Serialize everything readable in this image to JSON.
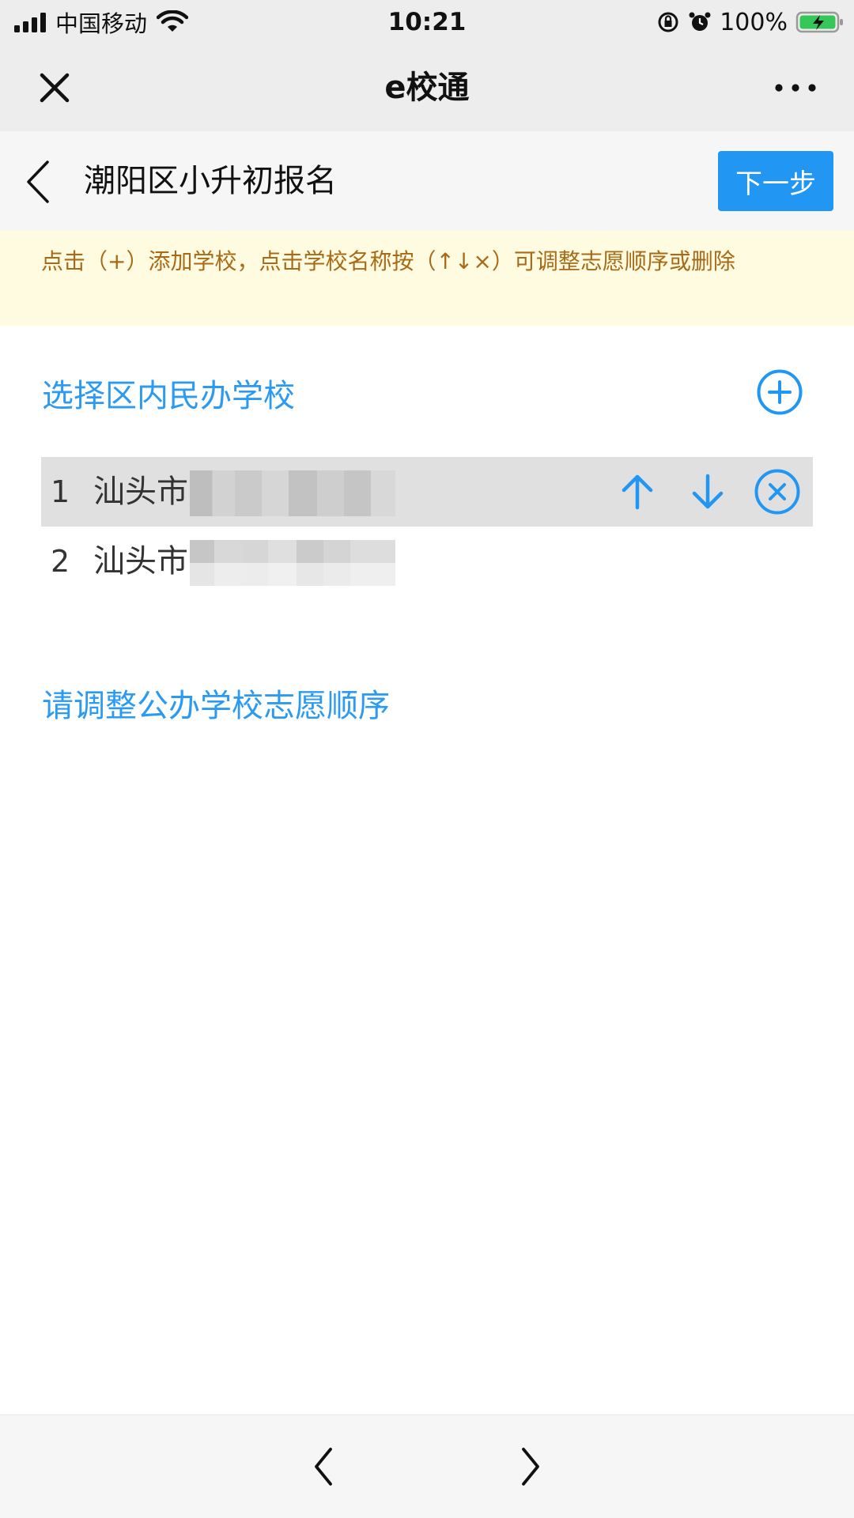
{
  "status_bar": {
    "carrier": "中国移动",
    "time": "10:21",
    "battery_percent": "100%"
  },
  "wechat_bar": {
    "title": "e校通",
    "close_icon": "close-icon",
    "more_icon": "more-icon"
  },
  "page_header": {
    "title": "潮阳区小升初报名",
    "next_button": "下一步",
    "back_icon": "chevron-left-icon"
  },
  "notice": {
    "text": "点击（+）添加学校，点击学校名称按（↑↓×）可调整志愿顺序或删除"
  },
  "private_section": {
    "title": "选择区内民办学校",
    "add_icon": "plus-circle-icon",
    "schools": [
      {
        "index": "1",
        "name": "汕头市",
        "selected": true
      },
      {
        "index": "2",
        "name": "汕头市",
        "selected": false
      }
    ],
    "row_actions": [
      "arrow-up-icon",
      "arrow-down-icon",
      "close-circle-icon"
    ]
  },
  "public_section": {
    "title": "请调整公办学校志愿顺序"
  },
  "bottom_nav": {
    "back_icon": "chevron-left-icon",
    "forward_icon": "chevron-right-icon"
  },
  "colors": {
    "accent": "#2196f3",
    "section_title": "#2b9af3",
    "notice_bg": "#fefbe1",
    "notice_text": "#a86a16",
    "selected_row": "#e0e0e0"
  }
}
